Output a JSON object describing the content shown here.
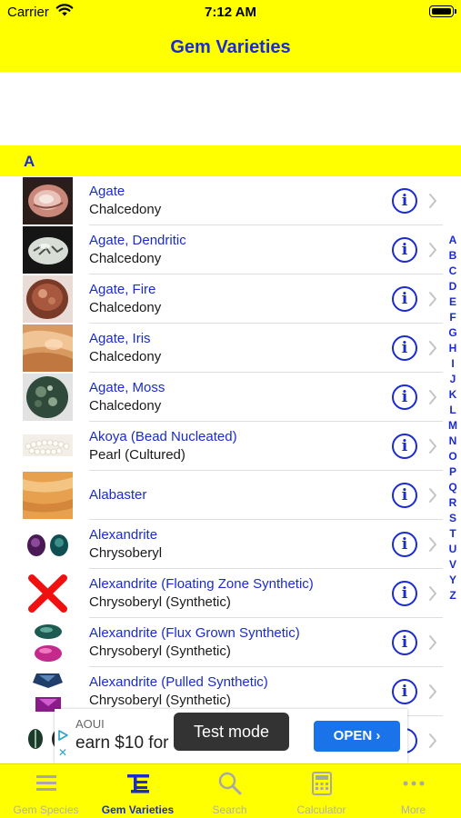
{
  "status_bar": {
    "carrier": "Carrier",
    "time": "7:12 AM"
  },
  "nav": {
    "title": "Gem Varieties"
  },
  "section": {
    "letter": "A"
  },
  "rows": [
    {
      "title": "Agate",
      "subtitle": "Chalcedony",
      "thumb": "agate-thumbnail"
    },
    {
      "title": "Agate, Dendritic",
      "subtitle": "Chalcedony",
      "thumb": "agate-dendritic-thumbnail"
    },
    {
      "title": "Agate, Fire",
      "subtitle": "Chalcedony",
      "thumb": "agate-fire-thumbnail"
    },
    {
      "title": "Agate, Iris",
      "subtitle": "Chalcedony",
      "thumb": "agate-iris-thumbnail"
    },
    {
      "title": "Agate, Moss",
      "subtitle": "Chalcedony",
      "thumb": "agate-moss-thumbnail"
    },
    {
      "title": "Akoya (Bead Nucleated)",
      "subtitle": "Pearl (Cultured)",
      "thumb": "pearl-necklace-thumbnail"
    },
    {
      "title": "Alabaster",
      "subtitle": "",
      "thumb": "alabaster-thumbnail"
    },
    {
      "title": "Alexandrite",
      "subtitle": "Chrysoberyl",
      "thumb": "alexandrite-thumbnail"
    },
    {
      "title": "Alexandrite (Floating Zone Synthetic)",
      "subtitle": "Chrysoberyl (Synthetic)",
      "thumb": "red-x-icon"
    },
    {
      "title": "Alexandrite (Flux Grown Synthetic)",
      "subtitle": "Chrysoberyl (Synthetic)",
      "thumb": "alexandrite-flux-thumbnail"
    },
    {
      "title": "Alexandrite (Pulled Synthetic)",
      "subtitle": "Chrysoberyl (Synthetic)",
      "thumb": "alexandrite-pulled-thumbnail"
    },
    {
      "title": "",
      "subtitle": "",
      "thumb": "alexandrite-cateye-thumbnail"
    }
  ],
  "index_letters": [
    "A",
    "B",
    "C",
    "D",
    "E",
    "F",
    "G",
    "H",
    "I",
    "J",
    "K",
    "L",
    "M",
    "N",
    "O",
    "P",
    "Q",
    "R",
    "S",
    "T",
    "U",
    "V",
    "Y",
    "Z"
  ],
  "ad": {
    "brand": "AOUI",
    "text": "earn $10 for",
    "cta": "OPEN ›"
  },
  "toast": {
    "text": "Test mode"
  },
  "tabs": [
    {
      "label": "Gem Species",
      "icon": "list-icon",
      "active": false
    },
    {
      "label": "Gem Varieties",
      "icon": "varieties-icon",
      "active": true
    },
    {
      "label": "Search",
      "icon": "search-icon",
      "active": false
    },
    {
      "label": "Calculator",
      "icon": "calculator-icon",
      "active": false
    },
    {
      "label": "More",
      "icon": "more-icon",
      "active": false
    }
  ],
  "colors": {
    "bar_yellow": "#ffff00",
    "accent_blue": "#1a2bd0",
    "inactive_gray": "#b0b0b0",
    "ad_button": "#1a73e8"
  }
}
